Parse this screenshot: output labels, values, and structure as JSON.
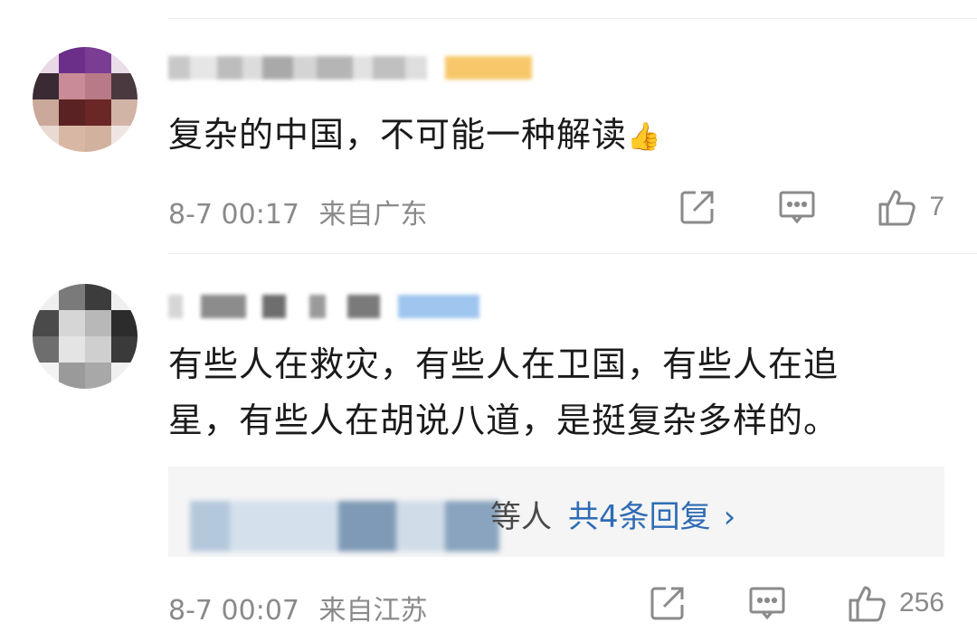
{
  "comments": [
    {
      "text": "复杂的中国，不可能一种解读",
      "emoji": "👍",
      "timestamp": "8-7 00:17",
      "location": "来自广东",
      "likes": "7"
    },
    {
      "text_line1": "有些人在救灾，有些人在卫国，有些人在追",
      "text_line2": "星，有些人在胡说八道，是挺复杂多样的。",
      "reply_suffix": "等人",
      "reply_link": "共4条回复",
      "reply_chevron": "›",
      "timestamp": "8-7 00:07",
      "location": "来自江苏",
      "likes": "256"
    }
  ],
  "icons": {
    "share": "share-icon",
    "comment": "comment-icon",
    "like": "thumbs-up-icon"
  },
  "colors": {
    "meta_gray": "#8a8a8a",
    "link_blue": "#2f6cb5",
    "reply_bg": "#f5f5f5"
  }
}
